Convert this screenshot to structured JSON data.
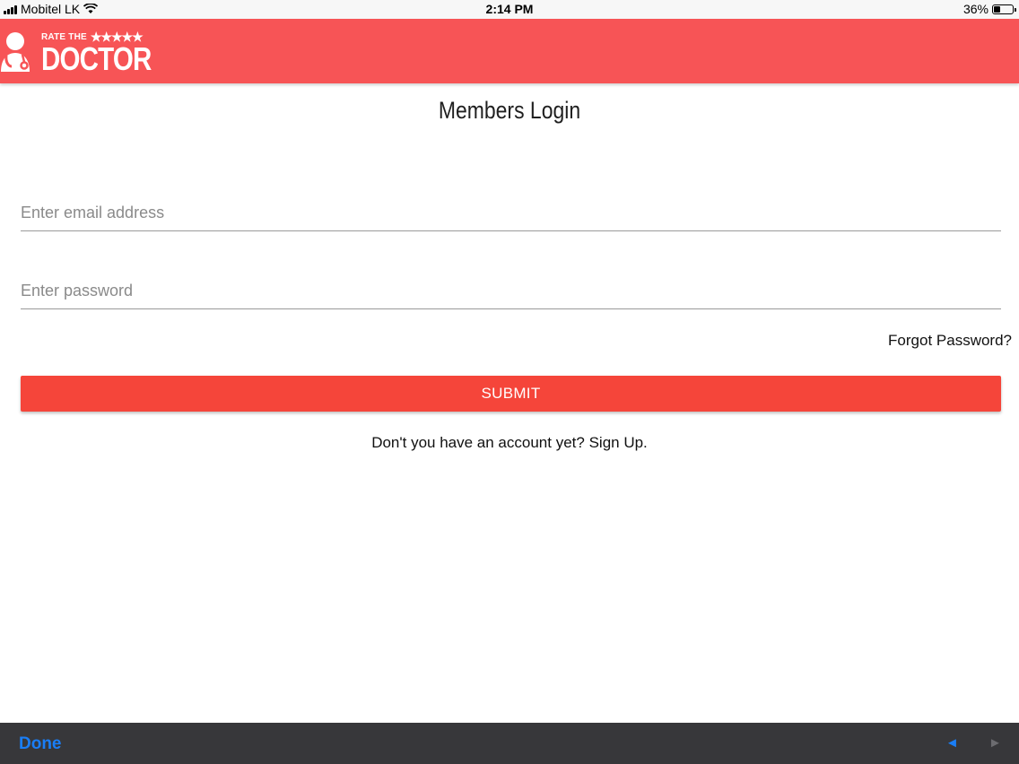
{
  "status_bar": {
    "carrier": "Mobitel LK",
    "time": "2:14 PM",
    "battery_percent": "36%",
    "battery_level": 0.36,
    "icons": [
      "signal-icon",
      "wifi-icon",
      "battery-icon"
    ]
  },
  "header": {
    "logo": {
      "small_text": "RATE THE",
      "stars": "★★★★★",
      "big_text": "DOCTOR",
      "icon": "doctor-icon"
    },
    "brand_color": "#f75456"
  },
  "main": {
    "title": "Members Login",
    "email": {
      "placeholder": "Enter email address",
      "value": ""
    },
    "password": {
      "placeholder": "Enter password",
      "value": ""
    },
    "forgot_label": "Forgot Password?",
    "submit_label": "SUBMIT",
    "submit_color": "#f5453a",
    "signup_prompt": "Don't you have an account yet?",
    "signup_link": "Sign Up."
  },
  "toolbar": {
    "done_label": "Done",
    "prev_icon": "◄",
    "next_icon": "►",
    "accent": "#1a7ef6"
  }
}
